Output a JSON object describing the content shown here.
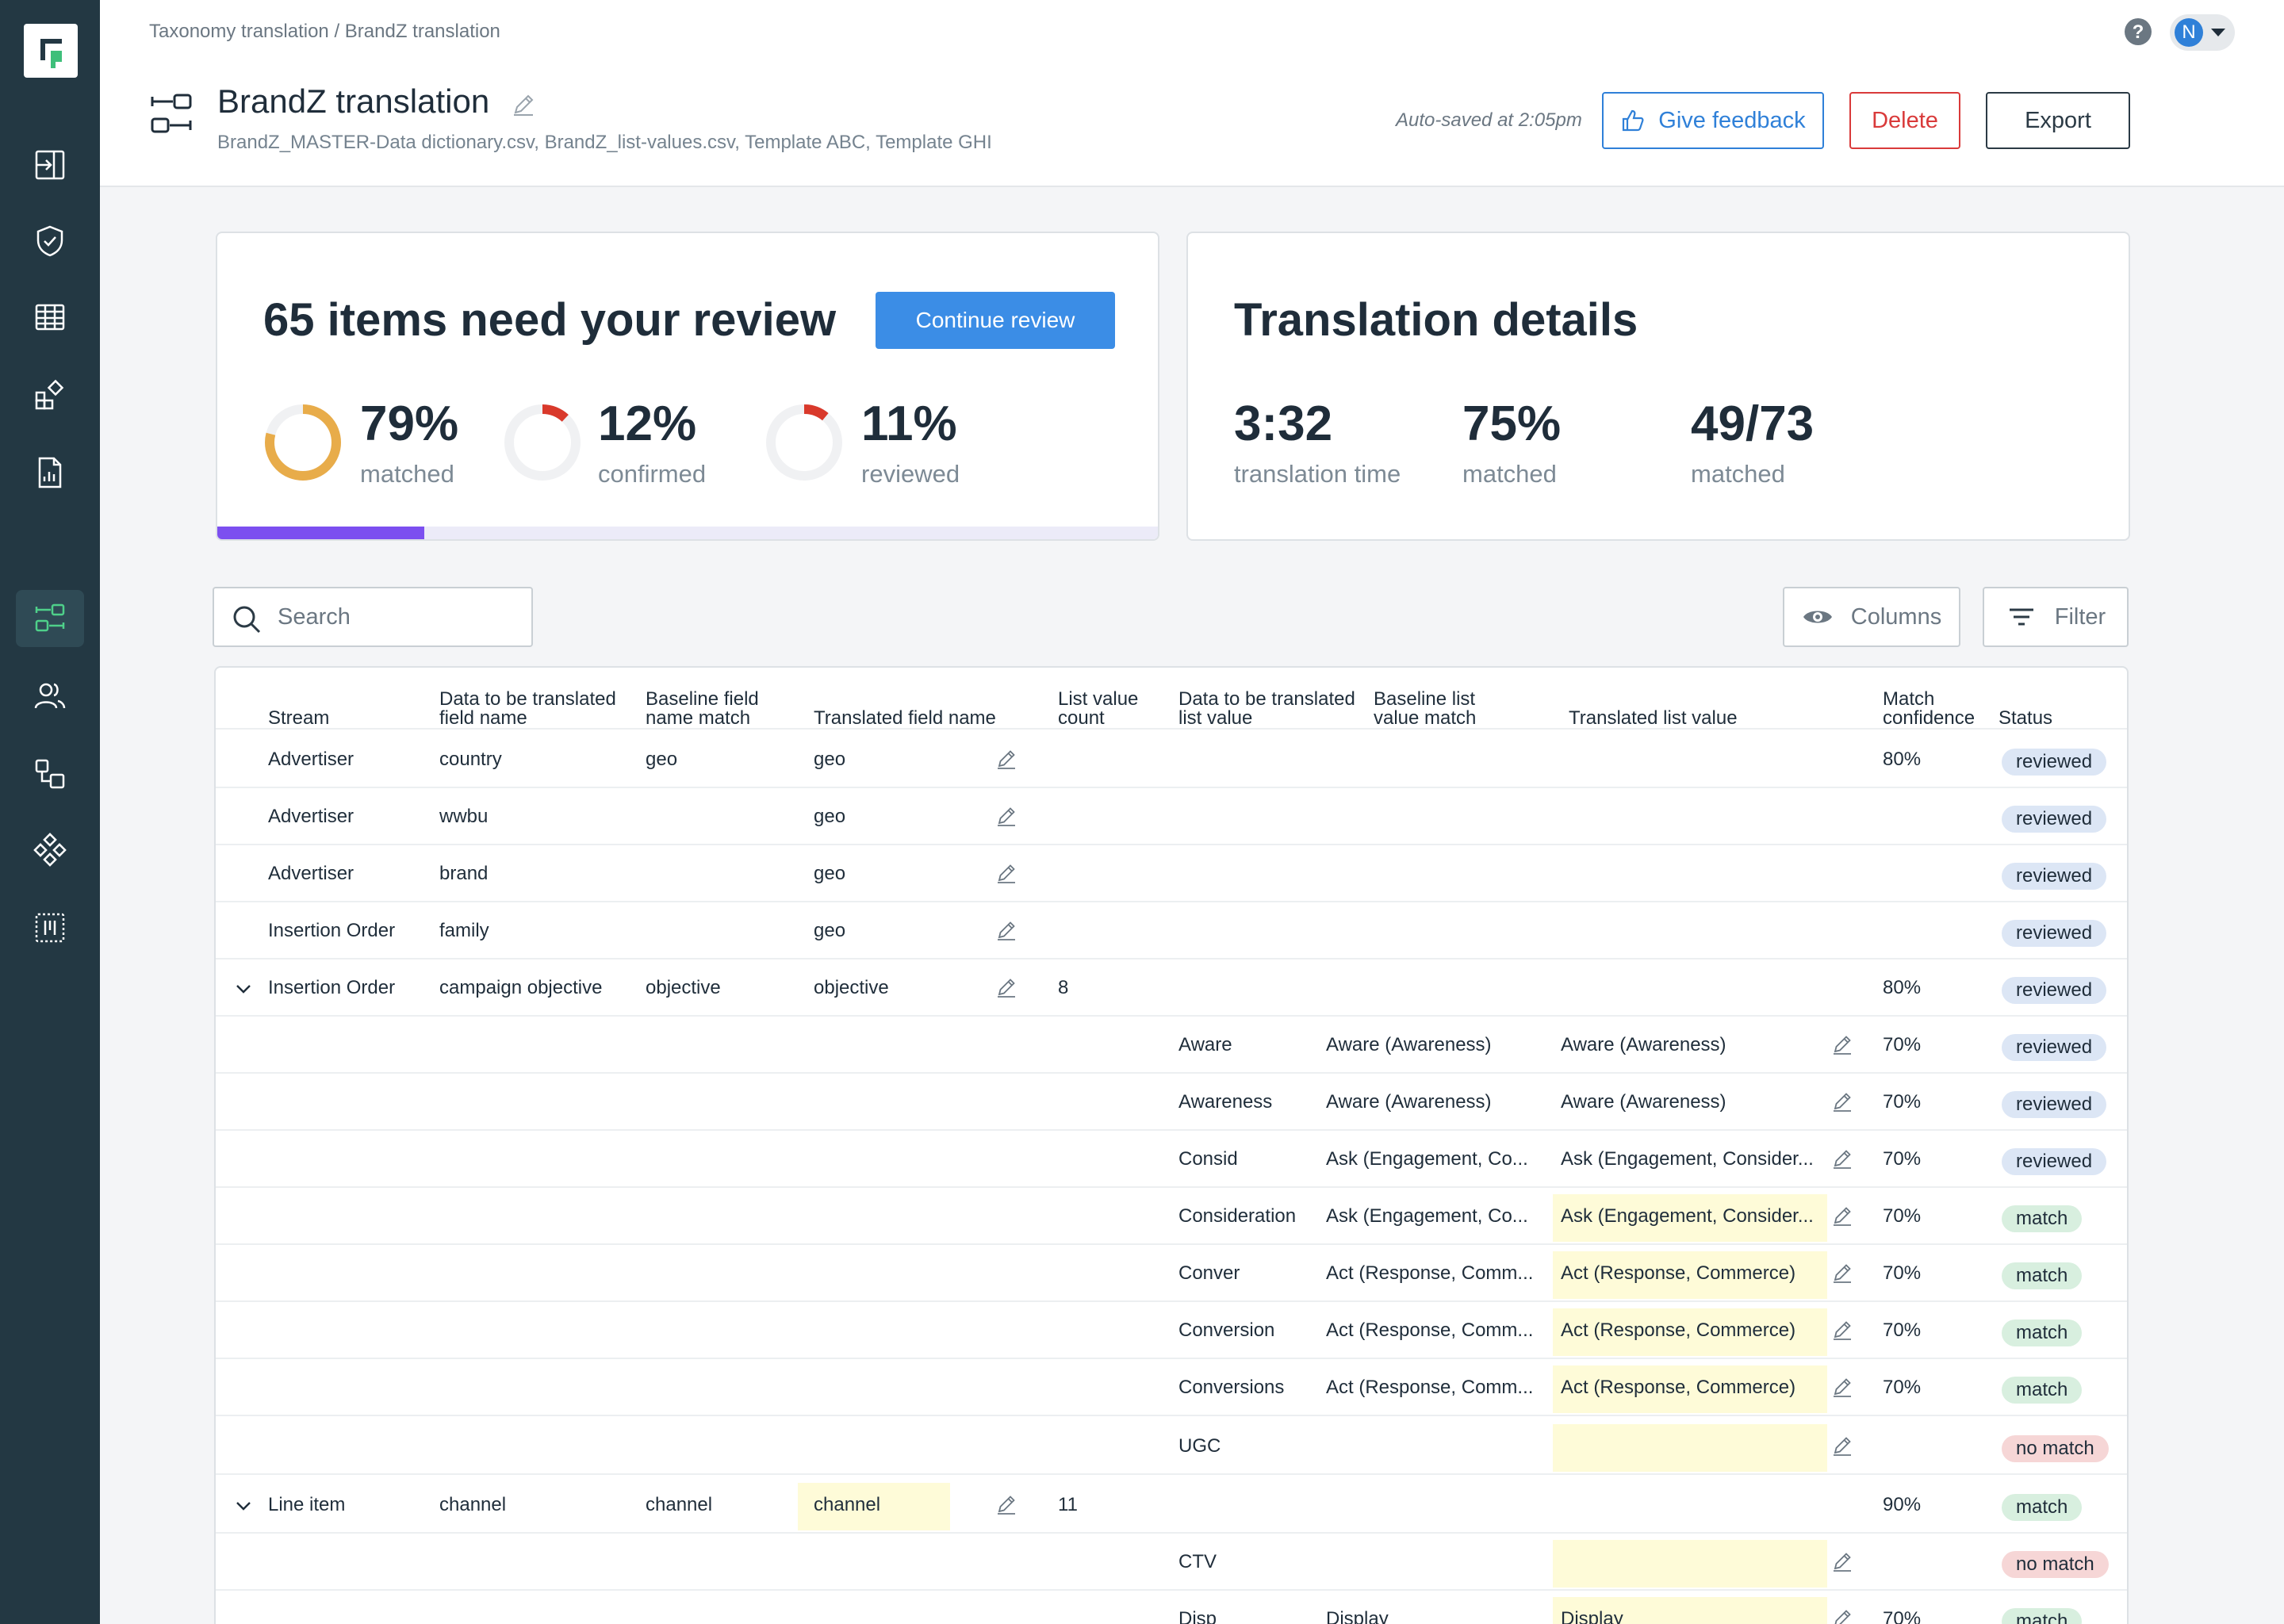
{
  "breadcrumb": "Taxonomy translation / BrandZ translation",
  "title": "BrandZ translation",
  "subtitle": "BrandZ_MASTER-Data dictionary.csv, BrandZ_list-values.csv, Template ABC, Template GHI",
  "autosave": "Auto-saved at 2:05pm",
  "buttons": {
    "feedback": "Give feedback",
    "delete": "Delete",
    "export": "Export",
    "continue": "Continue review"
  },
  "user": {
    "initial": "N"
  },
  "colors": {
    "sidebar": "#233843",
    "accent_blue": "#3b8de6",
    "danger": "#d93a3a",
    "progress": "#7c4ff0",
    "donut_matched": "#e8ac4a",
    "donut_small": "#d9392b"
  },
  "review": {
    "title": "65 items need your review",
    "progress_fraction": 0.22,
    "stats": [
      {
        "value": "79%",
        "label": "matched",
        "fraction": 0.79
      },
      {
        "value": "12%",
        "label": "confirmed",
        "fraction": 0.12
      },
      {
        "value": "11%",
        "label": "reviewed",
        "fraction": 0.11
      }
    ]
  },
  "details": {
    "title": "Translation details",
    "stats": [
      {
        "value": "3:32",
        "label": "translation time"
      },
      {
        "value": "75%",
        "label": "matched"
      },
      {
        "value": "49/73",
        "label": "matched"
      }
    ]
  },
  "toolbar": {
    "search_placeholder": "Search",
    "columns": "Columns",
    "filter": "Filter"
  },
  "table": {
    "headers": {
      "stream": "Stream",
      "field_name_1": "Data to be translated",
      "field_name_2": "field name",
      "baseline_field_1": "Baseline field",
      "baseline_field_2": "name match",
      "translated_field": "Translated field name",
      "list_count_1": "List value",
      "list_count_2": "count",
      "list_value_1": "Data to be translated",
      "list_value_2": "list value",
      "baseline_list_1": "Baseline list",
      "baseline_list_2": "value match",
      "translated_list": "Translated list value",
      "confidence_1": "Match",
      "confidence_2": "confidence",
      "status": "Status"
    },
    "rows": [
      {
        "stream": "Advertiser",
        "field": "country",
        "baseline_field": "geo",
        "translated_field": "geo",
        "count": "",
        "list_value": "",
        "baseline_list": "",
        "translated_list": "",
        "confidence": "80%",
        "status": "reviewed"
      },
      {
        "stream": "Advertiser",
        "field": "wwbu",
        "baseline_field": "",
        "translated_field": "geo",
        "count": "",
        "list_value": "",
        "baseline_list": "",
        "translated_list": "",
        "confidence": "",
        "status": "reviewed"
      },
      {
        "stream": "Advertiser",
        "field": "brand",
        "baseline_field": "",
        "translated_field": "geo",
        "count": "",
        "list_value": "",
        "baseline_list": "",
        "translated_list": "",
        "confidence": "",
        "status": "reviewed"
      },
      {
        "stream": "Insertion Order",
        "field": "family",
        "baseline_field": "",
        "translated_field": "geo",
        "count": "",
        "list_value": "",
        "baseline_list": "",
        "translated_list": "",
        "confidence": "",
        "status": "reviewed"
      },
      {
        "stream": "Insertion Order",
        "field": "campaign objective",
        "baseline_field": "objective",
        "translated_field": "objective",
        "count": "8",
        "list_value": "",
        "baseline_list": "",
        "translated_list": "",
        "confidence": "80%",
        "status": "reviewed"
      },
      {
        "stream": "",
        "field": "",
        "baseline_field": "",
        "translated_field": "",
        "count": "",
        "list_value": "Aware",
        "baseline_list": "Aware (Awareness)",
        "translated_list": "Aware (Awareness)",
        "confidence": "70%",
        "status": "reviewed"
      },
      {
        "stream": "",
        "field": "",
        "baseline_field": "",
        "translated_field": "",
        "count": "",
        "list_value": "Awareness",
        "baseline_list": "Aware (Awareness)",
        "translated_list": "Aware (Awareness)",
        "confidence": "70%",
        "status": "reviewed"
      },
      {
        "stream": "",
        "field": "",
        "baseline_field": "",
        "translated_field": "",
        "count": "",
        "list_value": "Consid",
        "baseline_list": "Ask (Engagement, Co...",
        "translated_list": "Ask (Engagement, Consider...",
        "confidence": "70%",
        "status": "reviewed"
      },
      {
        "stream": "",
        "field": "",
        "baseline_field": "",
        "translated_field": "",
        "count": "",
        "list_value": "Consideration",
        "baseline_list": "Ask (Engagement, Co...",
        "translated_list": "Ask (Engagement, Consider...",
        "confidence": "70%",
        "status": "match"
      },
      {
        "stream": "",
        "field": "",
        "baseline_field": "",
        "translated_field": "",
        "count": "",
        "list_value": "Conver",
        "baseline_list": "Act (Response, Comm...",
        "translated_list": "Act (Response, Commerce)",
        "confidence": "70%",
        "status": "match"
      },
      {
        "stream": "",
        "field": "",
        "baseline_field": "",
        "translated_field": "",
        "count": "",
        "list_value": "Conversion",
        "baseline_list": "Act (Response, Comm...",
        "translated_list": "Act (Response, Commerce)",
        "confidence": "70%",
        "status": "match"
      },
      {
        "stream": "",
        "field": "",
        "baseline_field": "",
        "translated_field": "",
        "count": "",
        "list_value": "Conversions",
        "baseline_list": "Act (Response, Comm...",
        "translated_list": "Act (Response, Commerce)",
        "confidence": "70%",
        "status": "match"
      },
      {
        "stream": "",
        "field": "",
        "baseline_field": "",
        "translated_field": "",
        "count": "",
        "list_value": "UGC",
        "baseline_list": "",
        "translated_list": "",
        "confidence": "",
        "status": "no match"
      },
      {
        "stream": "Line item",
        "field": "channel",
        "baseline_field": "channel",
        "translated_field": "channel",
        "count": "11",
        "list_value": "",
        "baseline_list": "",
        "translated_list": "",
        "confidence": "90%",
        "status": "match"
      },
      {
        "stream": "",
        "field": "",
        "baseline_field": "",
        "translated_field": "",
        "count": "",
        "list_value": "CTV",
        "baseline_list": "",
        "translated_list": "",
        "confidence": "",
        "status": "no match"
      },
      {
        "stream": "",
        "field": "",
        "baseline_field": "",
        "translated_field": "",
        "count": "",
        "list_value": "Disp",
        "baseline_list": "Display",
        "translated_list": "Display",
        "confidence": "70%",
        "status": "match"
      }
    ]
  }
}
